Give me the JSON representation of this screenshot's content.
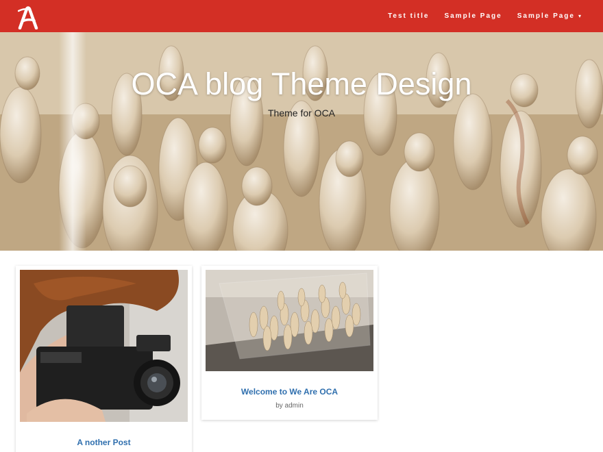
{
  "navbar": {
    "logo_letter": "A",
    "items": [
      {
        "label": "Test title"
      },
      {
        "label": "Sample Page"
      },
      {
        "label": "Sample Page",
        "has_dropdown": true
      }
    ],
    "caret_glyph": "⌄",
    "background": "#d32f25"
  },
  "hero": {
    "title": "OCA blog Theme Design",
    "subtitle": "Theme for OCA"
  },
  "posts": [
    {
      "title": "A nother Post",
      "image": "photographer-camera-photo"
    },
    {
      "title": "Welcome to We Are OCA",
      "meta": "by admin",
      "image": "sculpture-figures-photo"
    }
  ],
  "colors": {
    "accent": "#d32f25",
    "link": "#2f6fae",
    "meta_text": "#666666"
  }
}
